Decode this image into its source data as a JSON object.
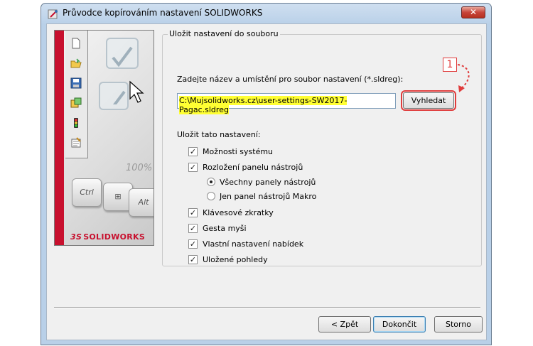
{
  "window": {
    "title": "Průvodce kopírováním nastavení SOLIDWORKS",
    "close_label": "✕"
  },
  "banner": {
    "toolbar_icons": [
      "new-document-icon",
      "open-folder-icon",
      "save-icon",
      "options-icon",
      "traffic-light-icon",
      "properties-icon"
    ],
    "percent_text": "100%",
    "keys": [
      "Ctrl",
      "⊞",
      "Alt"
    ],
    "logo_ds": "3S",
    "logo_text": "SOLIDWORKS"
  },
  "group": {
    "legend": "Uložit nastavení do souboru",
    "prompt": "Zadejte název a umístění pro soubor nastavení (*.sldreg):",
    "path_value": "C:\\Mujsolidworks.cz\\user-settings-SW2017-Pagac.sldreg",
    "search_label": "Vyhledat",
    "save_these_label": "Uložit tato nastavení:",
    "options": [
      {
        "label": "Možnosti systému",
        "checked": true
      },
      {
        "label": "Rozložení panelu nástrojů",
        "checked": true
      },
      {
        "label": "Klávesové zkratky",
        "checked": true
      },
      {
        "label": "Gesta myši",
        "checked": true
      },
      {
        "label": "Vlastní nastavení nabídek",
        "checked": true
      },
      {
        "label": "Uložené pohledy",
        "checked": true
      }
    ],
    "radios": [
      {
        "label": "Všechny panely nástrojů",
        "selected": true
      },
      {
        "label": "Jen panel nástrojů Makro",
        "selected": false
      }
    ]
  },
  "annotation": {
    "callout_number": "1",
    "accent_color": "#e03c3c"
  },
  "footer": {
    "back_label": "< Zpět",
    "finish_label": "Dokončit",
    "cancel_label": "Storno"
  }
}
